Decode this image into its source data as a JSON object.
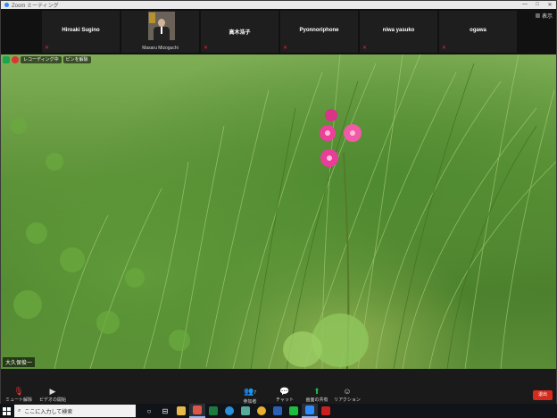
{
  "window": {
    "title": "Zoom ミーティング",
    "controls": [
      "—",
      "□",
      "✕"
    ]
  },
  "strip": {
    "view_label": "表示",
    "participants": [
      {
        "name": "Hiroaki Sugino",
        "muted": true
      },
      {
        "name": "Masaru Mizoguchi",
        "has_photo": true,
        "muted": false
      },
      {
        "name": "高木浩子",
        "muted": true
      },
      {
        "name": "Pyonnoriphone",
        "muted": true
      },
      {
        "name": "niwa yasuko",
        "muted": true
      },
      {
        "name": "ogawa",
        "muted": true
      }
    ]
  },
  "video": {
    "status_chip": "レコーディング中",
    "pin_label": "ピンを解除",
    "speaker_name": "大久保俊一"
  },
  "toolbar": {
    "mute": "ミュート解除",
    "video": "ビデオの開始",
    "participants": "参加者",
    "participant_count": "7",
    "chat": "チャット",
    "share": "画面の共有",
    "reactions": "リアクション",
    "end": "退出"
  },
  "taskbar": {
    "search_placeholder": "ここに入力して検索"
  },
  "colors": {
    "zoom_blue": "#2d8cff",
    "end_red": "#d52b1e",
    "share_green": "#24b34a",
    "mute_red": "#e23333"
  }
}
